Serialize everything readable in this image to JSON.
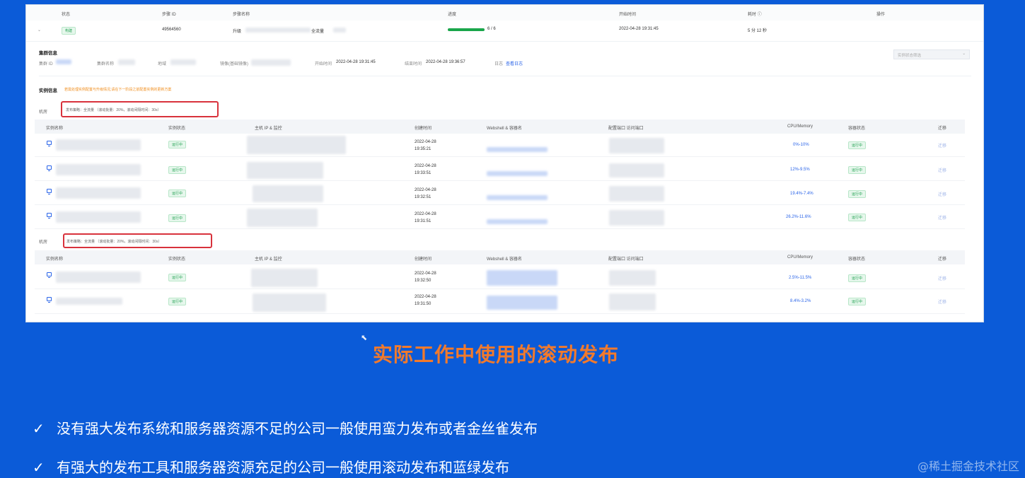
{
  "job_table": {
    "headers": [
      "状态",
      "步骤 ID",
      "步骤名称",
      "进度",
      "开始时间",
      "耗时",
      "操作"
    ],
    "row": {
      "status": "构建",
      "step_id": "49564560",
      "step_name_prefix": "升级",
      "step_name_suffix": "全流量",
      "progress": 1.0,
      "progress_text": "6 / 6",
      "start_time": "2022-04-28 19:31:45",
      "duration": "5 分 12 秒"
    }
  },
  "cluster_info": {
    "title": "集群信息",
    "fields": {
      "cluster_id": "集群 ID",
      "cluster_name": "集群名称",
      "region": "地域",
      "image": "镜像(基础镜像)",
      "start_label": "开始时间",
      "start_value": "2022-04-28 19:31:45",
      "end_label": "结束时间",
      "end_value": "2022-04-28 19:36:57",
      "log_label": "日志",
      "log_link": "查看日志"
    }
  },
  "instance_info": {
    "title": "实例信息",
    "notice": "若需处理实例配置与升级情况,请在下一阶段之前配置实例的更新方案",
    "filter_placeholder": "实例状态筛选",
    "groups": [
      {
        "label": "机房",
        "strategy": "发布策略：全流量 （滚动批量：20%，滚动间隔时间：30s）",
        "rows": [
          {
            "created_date": "2022-04-28",
            "created_time": "19:35:21",
            "usage": "0%-10%",
            "status": "运行中",
            "vm_status": "运行中",
            "action": "迁移"
          },
          {
            "created_date": "2022-04-28",
            "created_time": "19:33:51",
            "usage": "12%-9.5%",
            "status": "运行中",
            "vm_status": "运行中",
            "action": "迁移"
          },
          {
            "created_date": "2022-04-28",
            "created_time": "19:32:51",
            "usage": "19.4%-7.4%",
            "status": "运行中",
            "vm_status": "运行中",
            "action": "迁移"
          },
          {
            "created_date": "2022-04-28",
            "created_time": "19:31:51",
            "usage": "26.2%-11.6%",
            "status": "运行中",
            "vm_status": "运行中",
            "action": "迁移"
          }
        ]
      },
      {
        "label": "机房",
        "strategy": "发布策略：全流量 （滚动批量：20%，滚动间隔时间：30s）",
        "rows": [
          {
            "created_date": "2022-04-28",
            "created_time": "19:32:50",
            "usage": "2.5%-11.5%",
            "status": "运行中",
            "vm_status": "运行中",
            "action": "迁移"
          },
          {
            "created_date": "2022-04-28",
            "created_time": "19:31:50",
            "usage": "8.4%-3.2%",
            "status": "运行中",
            "vm_status": "运行中",
            "action": "迁移"
          }
        ]
      }
    ],
    "columns": [
      "实例名称",
      "实例状态",
      "主机 IP & 监控",
      "创建时间",
      "Webshell & 容器名",
      "配置端口 访问端口",
      "CPU/Memory",
      "容器状态",
      "迁移"
    ]
  },
  "slide": {
    "caption": "实际工作中使用的滚动发布",
    "bullets": [
      "没有强大发布系统和服务器资源不足的公司一般使用蛮力发布或者金丝雀发布",
      "有强大的发布工具和服务器资源充足的公司一般使用滚动发布和蓝绿发布"
    ],
    "check_glyph": "✓",
    "watermark": "@稀土掘金技术社区"
  },
  "icons": {
    "expand": "chevron-down-icon",
    "instance": "vm-icon",
    "info": "info-circle-icon",
    "cursor": "mouse-pointer-icon"
  },
  "colors": {
    "background": "#0b5bd8",
    "caption": "#f27a2c",
    "progress": "#1aa64b",
    "running": "#1fa04f",
    "link": "#2a64e8",
    "highlight": "#d8323c"
  }
}
